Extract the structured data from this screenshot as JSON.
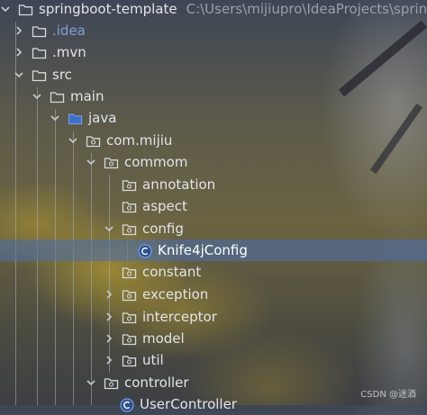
{
  "project": {
    "name": "springboot-template",
    "path": "C:\\Users\\mijiupro\\IdeaProjects\\sprin"
  },
  "tree": {
    "idea": ".idea",
    "mvn": ".mvn",
    "src": "src",
    "main": "main",
    "java": "java",
    "com_mijiu": "com.mijiu",
    "commom": "commom",
    "annotation": "annotation",
    "aspect": "aspect",
    "config": "config",
    "knife4j": "Knife4jConfig",
    "constant": "constant",
    "exception": "exception",
    "interceptor": "interceptor",
    "model": "model",
    "util": "util",
    "controller": "controller",
    "user_controller": "UserController"
  },
  "watermark": "CSDN @迷酒",
  "colors": {
    "selection": "#4b6eaf",
    "class_icon": "#4c8cf5",
    "idea_label": "#7fa0d9"
  }
}
